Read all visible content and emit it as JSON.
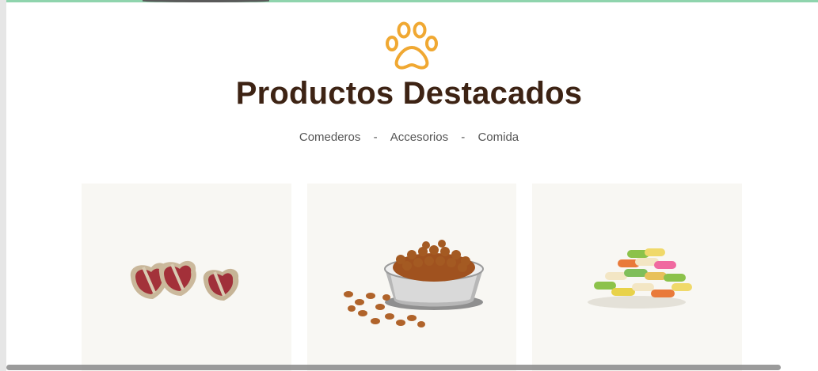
{
  "section": {
    "icon": "paw-icon",
    "title": "Productos Destacados"
  },
  "filters": {
    "items": [
      "Comederos",
      "Accesorios",
      "Comida"
    ],
    "separator": "-"
  },
  "products": [
    {
      "image": "steak-shaped-dog-treats"
    },
    {
      "image": "kibble-bowl"
    },
    {
      "image": "bone-shaped-biscuits"
    }
  ],
  "colors": {
    "accent": "#f0a832",
    "title": "#3d2314",
    "top_border": "#8fd4ad",
    "card_bg": "#f8f7f3"
  }
}
